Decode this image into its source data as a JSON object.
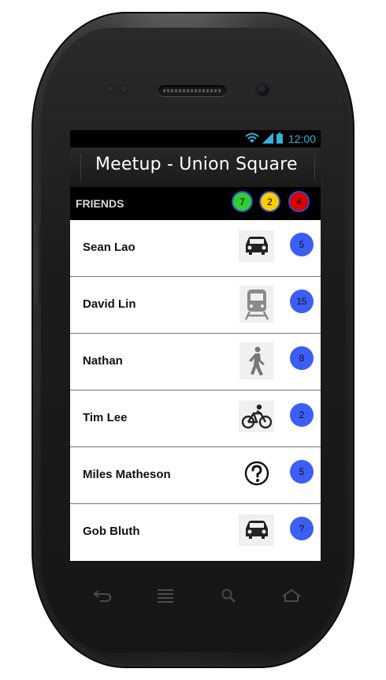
{
  "status_bar": {
    "time": "12:00",
    "icons": [
      "wifi-icon",
      "signal-icon",
      "battery-icon"
    ],
    "color": "#3ab0e0"
  },
  "header": {
    "title": "Meetup - Union Square"
  },
  "friends_bar": {
    "label": "FRIENDS",
    "counts": [
      {
        "value": "7",
        "color": "#33cc33"
      },
      {
        "value": "2",
        "color": "#ffcc00"
      },
      {
        "value": "4",
        "color": "#dd0000"
      }
    ]
  },
  "friends": [
    {
      "name": "Sean Lao",
      "mode": "car-icon",
      "eta": "5"
    },
    {
      "name": "David Lin",
      "mode": "train-icon",
      "eta": "15"
    },
    {
      "name": "Nathan",
      "mode": "walking-icon",
      "eta": "8"
    },
    {
      "name": "Tim Lee",
      "mode": "bicycle-icon",
      "eta": "2"
    },
    {
      "name": "Miles Matheson",
      "mode": "question-icon",
      "eta": "5"
    },
    {
      "name": "Gob Bluth",
      "mode": "car-icon",
      "eta": "?"
    }
  ],
  "nav_keys": [
    "back-icon",
    "menu-icon",
    "search-icon",
    "home-icon"
  ],
  "colors": {
    "eta_badge": "#3b5ef5",
    "screen_header": "#1a1a1a"
  }
}
